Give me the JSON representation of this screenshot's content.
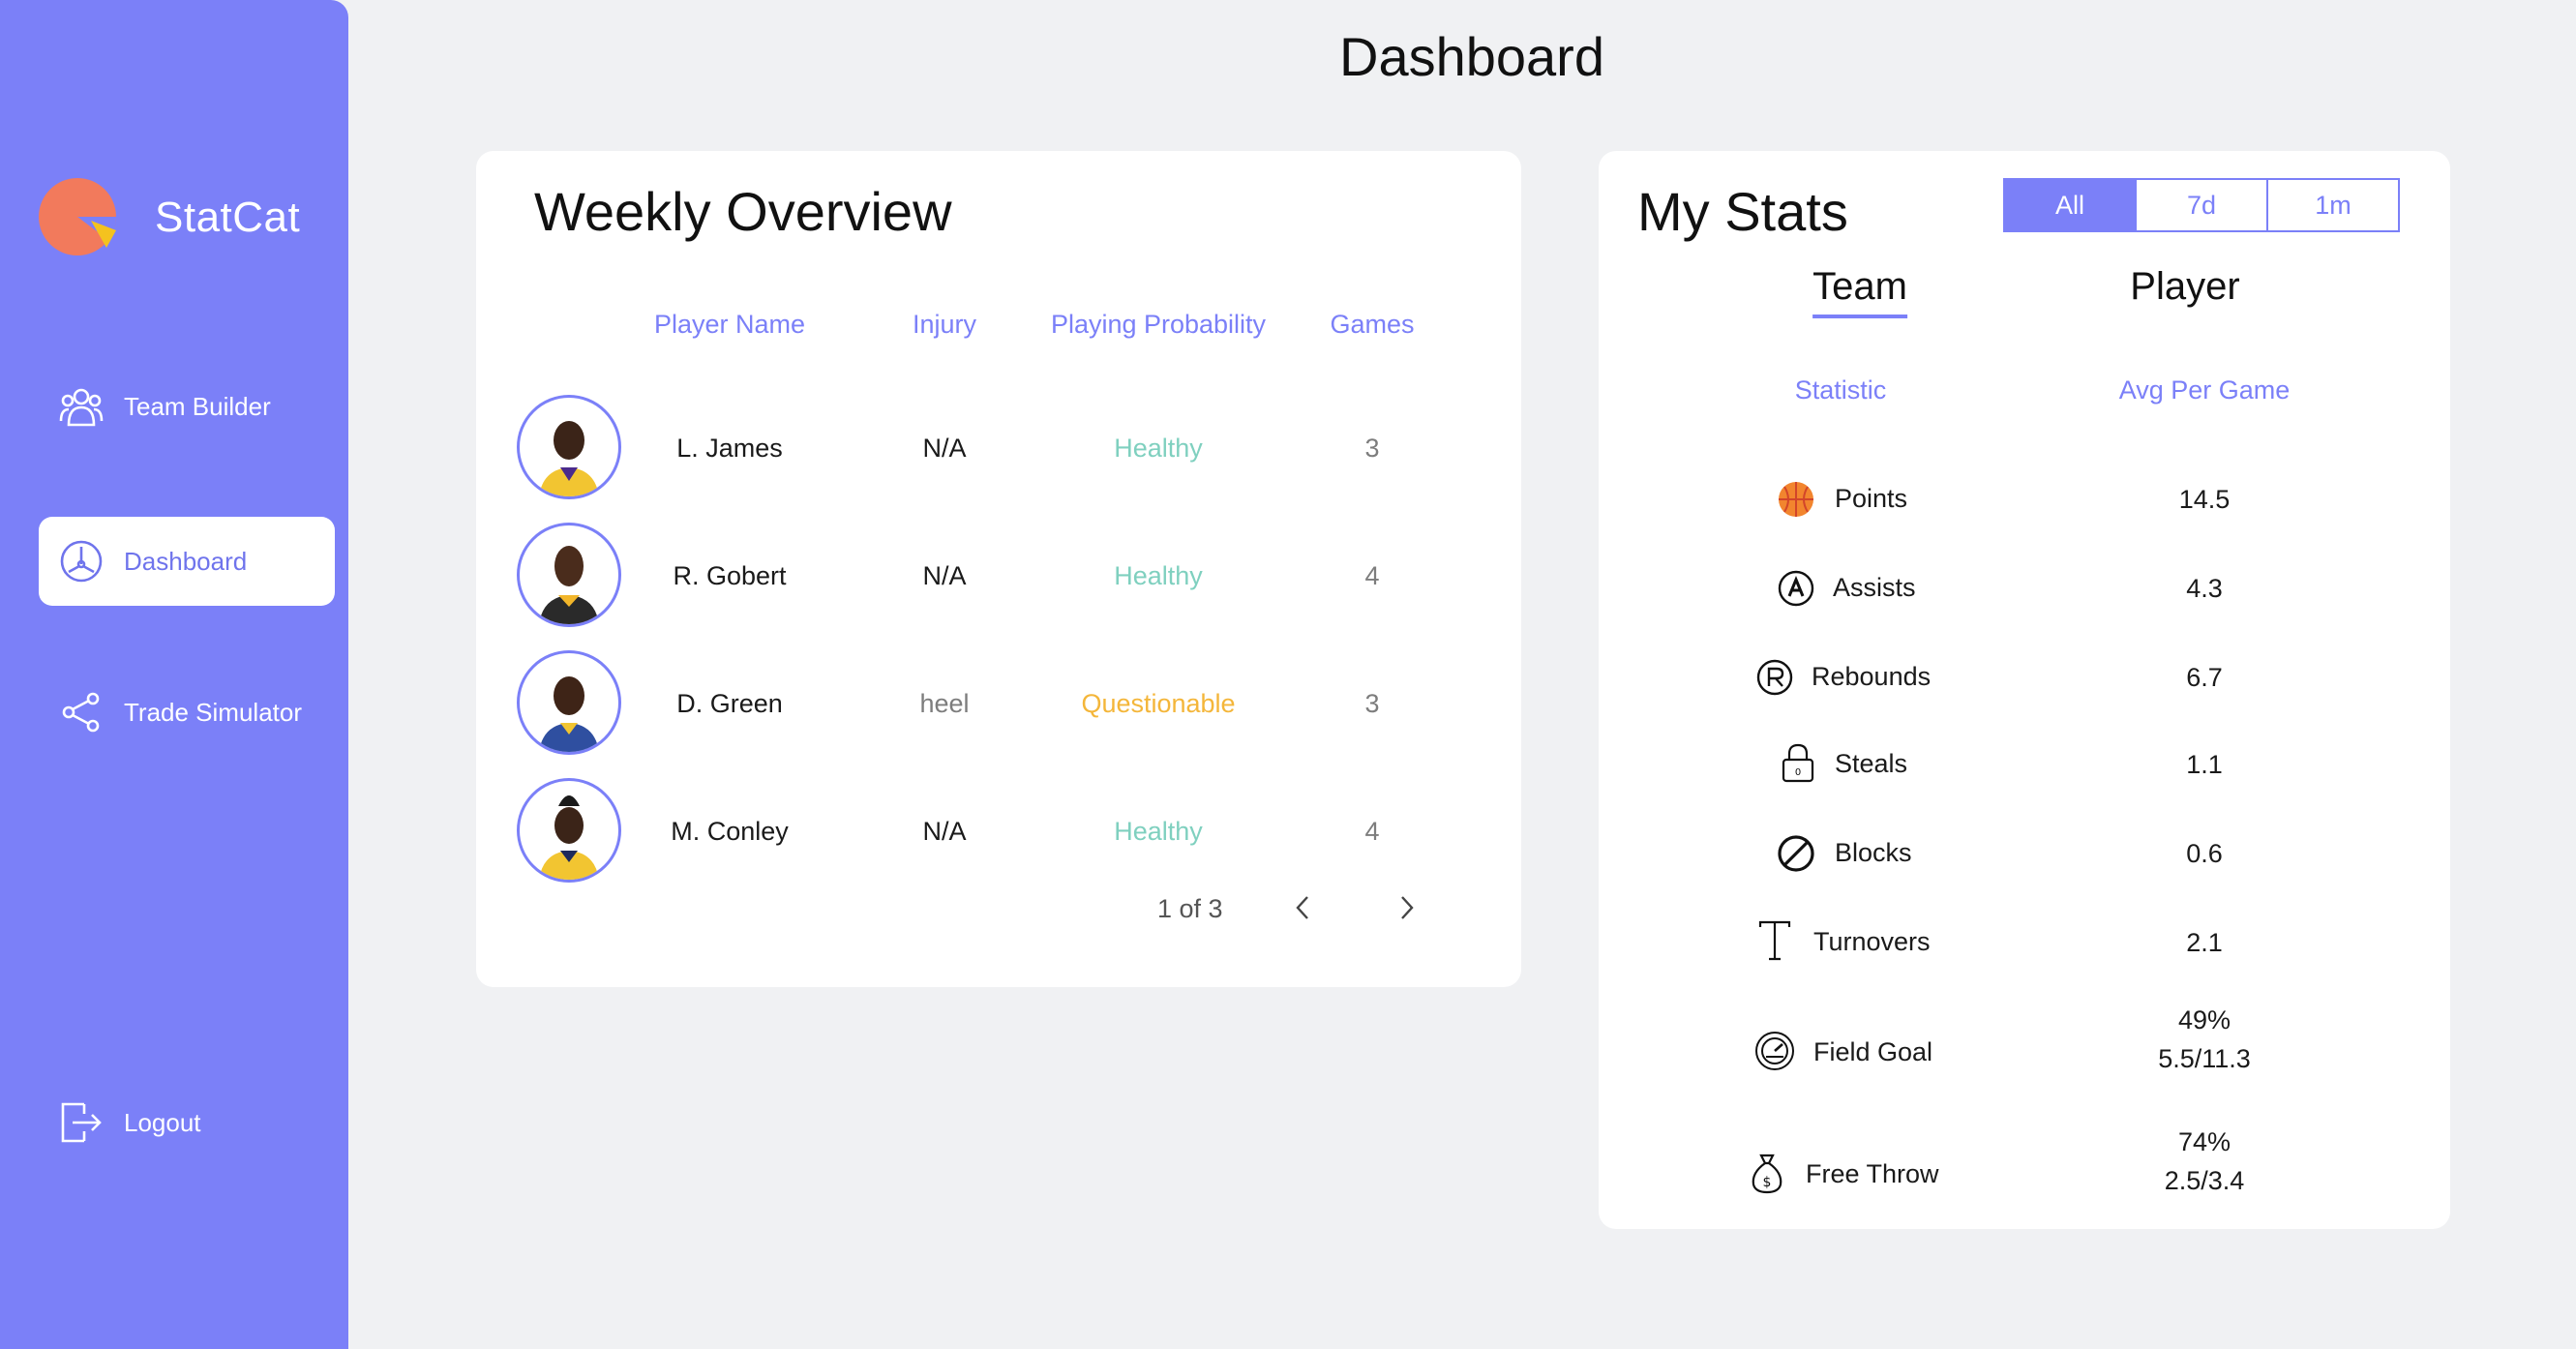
{
  "page_title": "Dashboard",
  "brand": {
    "name": "StatCat"
  },
  "sidebar": {
    "items": [
      {
        "label": "Team Builder",
        "icon": "people-icon"
      },
      {
        "label": "Dashboard",
        "icon": "dashboard-gauge-icon"
      },
      {
        "label": "Trade Simulator",
        "icon": "share-icon"
      }
    ],
    "logout_label": "Logout"
  },
  "weekly": {
    "title": "Weekly Overview",
    "columns": [
      "Player Name",
      "Injury",
      "Playing Probability",
      "Games"
    ],
    "rows": [
      {
        "name": "L. James",
        "injury": "N/A",
        "probability": "Healthy",
        "games": "3"
      },
      {
        "name": "R. Gobert",
        "injury": "N/A",
        "probability": "Healthy",
        "games": "4"
      },
      {
        "name": "D. Green",
        "injury": "heel",
        "probability": "Questionable",
        "games": "3"
      },
      {
        "name": "M. Conley",
        "injury": "N/A",
        "probability": "Healthy",
        "games": "4"
      }
    ],
    "pager": "1 of 3"
  },
  "stats": {
    "title": "My Stats",
    "filters": [
      "All",
      "7d",
      "1m"
    ],
    "active_filter": "All",
    "tabs": [
      "Team",
      "Player"
    ],
    "active_tab": "Team",
    "columns": [
      "Statistic",
      "Avg Per Game"
    ],
    "rows": [
      {
        "label": "Points",
        "value": "14.5",
        "value2": ""
      },
      {
        "label": "Assists",
        "value": "4.3",
        "value2": ""
      },
      {
        "label": "Rebounds",
        "value": "6.7",
        "value2": ""
      },
      {
        "label": "Steals",
        "value": "1.1",
        "value2": ""
      },
      {
        "label": "Blocks",
        "value": "0.6",
        "value2": ""
      },
      {
        "label": "Turnovers",
        "value": "2.1",
        "value2": ""
      },
      {
        "label": "Field Goal",
        "value": "49%",
        "value2": "5.5/11.3"
      },
      {
        "label": "Free Throw",
        "value": "74%",
        "value2": "2.5/3.4"
      }
    ]
  },
  "colors": {
    "accent": "#7b80f8",
    "healthy": "#7fd0bf",
    "questionable": "#f4b63a",
    "logo": "#f27a5c"
  }
}
